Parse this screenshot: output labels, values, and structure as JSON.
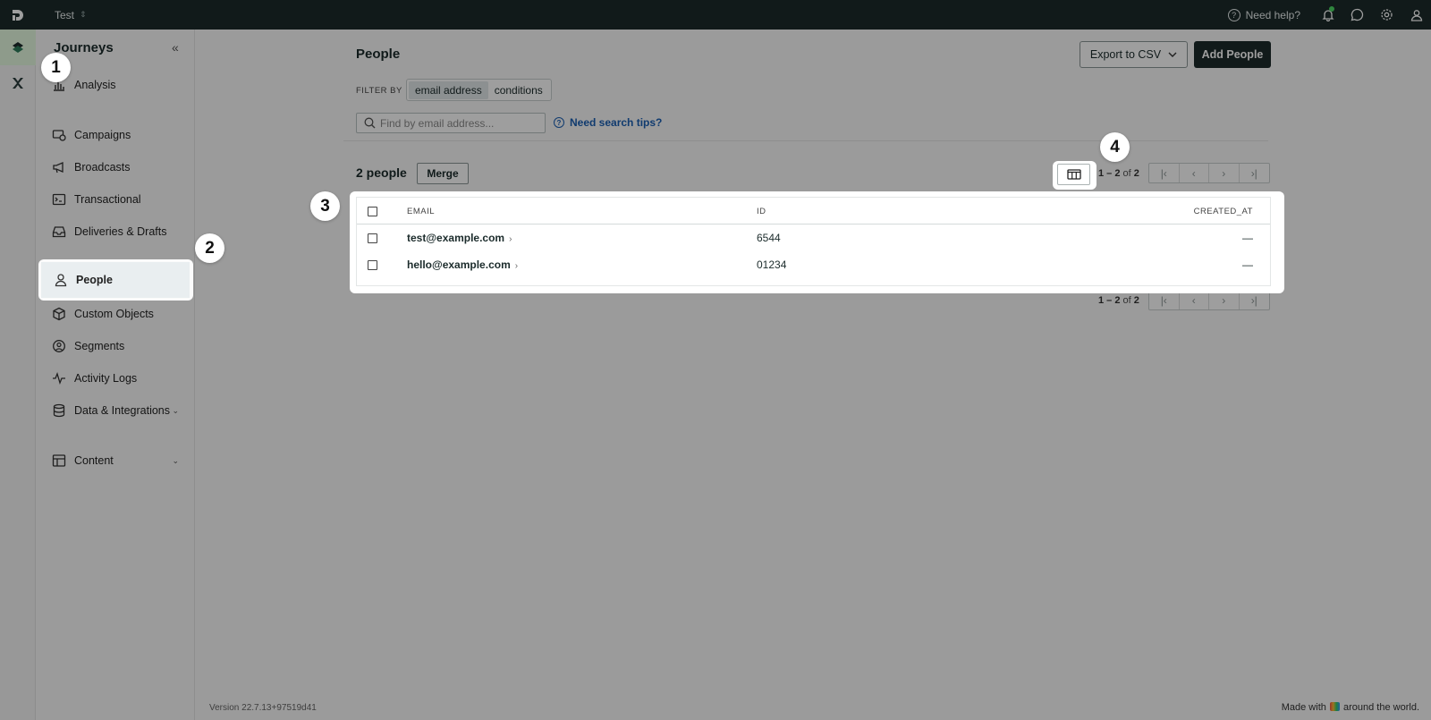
{
  "topbar": {
    "workspace": "Test",
    "help_label": "Need help?",
    "icons": [
      "bell-icon",
      "chat-icon",
      "gear-icon",
      "user-icon"
    ]
  },
  "sidebar": {
    "title": "Journeys",
    "items": [
      {
        "label": "Analysis",
        "icon": "bar-chart-icon"
      },
      {
        "label": "Campaigns",
        "icon": "campaign-icon"
      },
      {
        "label": "Broadcasts",
        "icon": "megaphone-icon"
      },
      {
        "label": "Transactional",
        "icon": "terminal-icon"
      },
      {
        "label": "Deliveries & Drafts",
        "icon": "inbox-icon"
      },
      {
        "label": "People",
        "icon": "person-icon",
        "active": true
      },
      {
        "label": "Custom Objects",
        "icon": "cube-icon"
      },
      {
        "label": "Segments",
        "icon": "segment-icon"
      },
      {
        "label": "Activity Logs",
        "icon": "pulse-icon"
      },
      {
        "label": "Data & Integrations",
        "icon": "database-icon",
        "expandable": true
      },
      {
        "label": "Content",
        "icon": "layout-icon",
        "expandable": true
      }
    ]
  },
  "main": {
    "title": "People",
    "export_label": "Export to CSV",
    "add_label": "Add People",
    "filter_by_label": "FILTER BY",
    "filter_options": [
      "email address",
      "conditions"
    ],
    "filter_selected": "email address",
    "search_placeholder": "Find by email address...",
    "search_tips": "Need search tips?",
    "count_label": "2 people",
    "merge_label": "Merge",
    "range_start": "1 – 2",
    "range_of": "of",
    "range_total": "2",
    "table": {
      "columns": [
        "EMAIL",
        "ID",
        "CREATED_AT"
      ],
      "rows": [
        {
          "email": "test@example.com",
          "id": "6544",
          "created_at": "—"
        },
        {
          "email": "hello@example.com",
          "id": "01234",
          "created_at": "—"
        }
      ]
    }
  },
  "footer": {
    "version": "Version 22.7.13+97519d41",
    "made_with_prefix": "Made with",
    "made_with_suffix": "around the world."
  },
  "annotations": [
    "1",
    "2",
    "3",
    "4"
  ],
  "colors": {
    "topbar": "#1c2b2b",
    "primary_button": "#1c2b2b",
    "link": "#1a5fb4",
    "active_rail": "#e6fbe0"
  }
}
